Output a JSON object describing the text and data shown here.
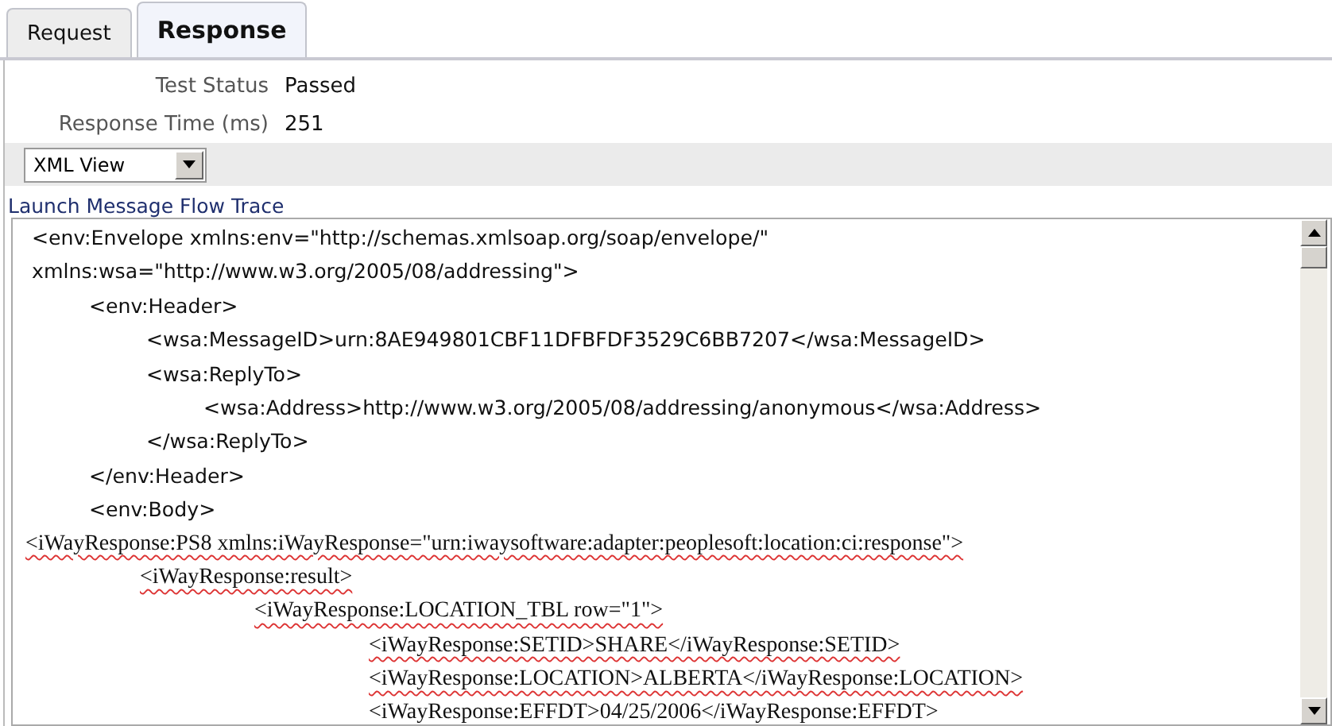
{
  "tabs": [
    {
      "label": "Request",
      "selected": false
    },
    {
      "label": "Response",
      "selected": true
    }
  ],
  "fields": [
    {
      "label": "Test Status",
      "value": "Passed"
    },
    {
      "label": "Response Time (ms)",
      "value": "251"
    }
  ],
  "view_select": {
    "value": "XML View"
  },
  "trace_link": "Launch Message Flow Trace",
  "xml_lines": [
    {
      "kind": "sans",
      "text": "<env:Envelope xmlns:env=\"http://schemas.xmlsoap.org/soap/envelope/\""
    },
    {
      "kind": "sans",
      "text": "xmlns:wsa=\"http://www.w3.org/2005/08/addressing\">",
      "children": [
        {
          "kind": "sans",
          "text": "<env:Header>",
          "children": [
            {
              "kind": "sans",
              "text": "<wsa:MessageID>urn:8AE949801CBF11DFBFDF3529C6BB7207</wsa:MessageID>"
            },
            {
              "kind": "sans",
              "text": "<wsa:ReplyTo>",
              "children": [
                {
                  "kind": "sans",
                  "text": "<wsa:Address>http://www.w3.org/2005/08/addressing/anonymous</wsa:Address>"
                }
              ]
            },
            {
              "kind": "sans",
              "text": "</wsa:ReplyTo>"
            }
          ]
        },
        {
          "kind": "sans",
          "text": "</env:Header>"
        },
        {
          "kind": "sans",
          "text": "<env:Body>"
        }
      ]
    },
    {
      "kind": "serif",
      "text": "<iWayResponse:PS8 xmlns:iWayResponse=\"urn:iwaysoftware:adapter:peoplesoft:location:ci:response\">",
      "children": [
        {
          "kind": "serif",
          "text": "<iWayResponse:result>",
          "children": [
            {
              "kind": "serif",
              "text": "<iWayResponse:LOCATION_TBL row=\"1\">",
              "children": [
                {
                  "kind": "serif",
                  "text": "<iWayResponse:SETID>SHARE</iWayResponse:SETID>"
                },
                {
                  "kind": "serif",
                  "text": "<iWayResponse:LOCATION>ALBERTA</iWayResponse:LOCATION>"
                },
                {
                  "kind": "serif",
                  "text": "<iWayResponse:EFFDT>04/25/2006</iWayResponse:EFFDT>"
                }
              ]
            }
          ]
        }
      ]
    }
  ]
}
